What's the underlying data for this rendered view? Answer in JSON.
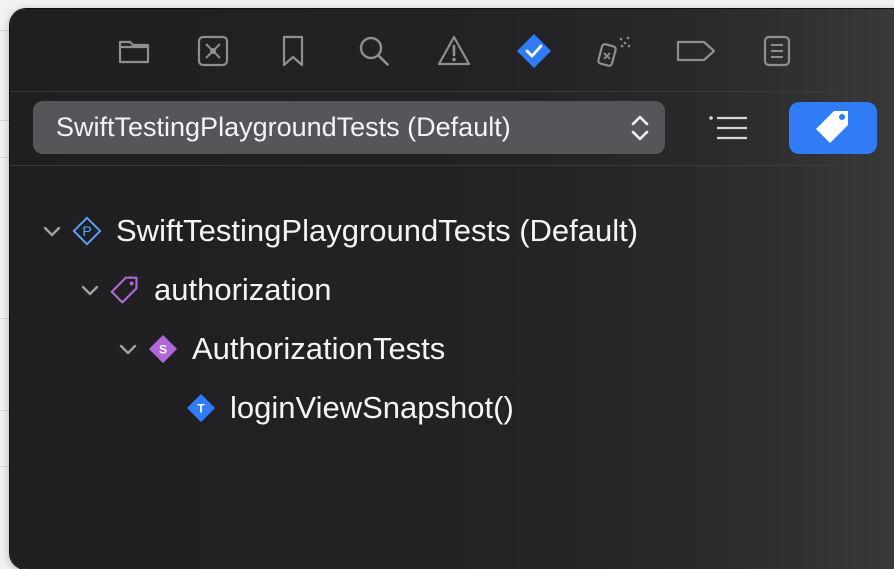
{
  "navigator": {
    "tabs": [
      {
        "name": "folder-icon"
      },
      {
        "name": "source-control-icon"
      },
      {
        "name": "bookmark-icon"
      },
      {
        "name": "search-icon"
      },
      {
        "name": "warning-icon"
      },
      {
        "name": "test-diamond-icon",
        "active": true
      },
      {
        "name": "debug-spray-icon"
      },
      {
        "name": "breakpoint-tag-icon"
      },
      {
        "name": "report-list-icon"
      }
    ],
    "accent_color": "#2f7cf6"
  },
  "scheme": {
    "selected": "SwiftTestingPlaygroundTests (Default)"
  },
  "tree": {
    "plan": {
      "label": "SwiftTestingPlaygroundTests (Default)",
      "icon": "test-plan-icon",
      "icon_letter": "P"
    },
    "tag": {
      "label": "authorization",
      "icon": "tag-icon",
      "color": "#b067d9"
    },
    "suite": {
      "label": "AuthorizationTests",
      "icon": "suite-icon",
      "icon_letter": "S",
      "color": "#b067d9"
    },
    "test": {
      "label": "loginViewSnapshot()",
      "icon": "test-icon",
      "icon_letter": "T",
      "color": "#2f7cf6"
    }
  }
}
